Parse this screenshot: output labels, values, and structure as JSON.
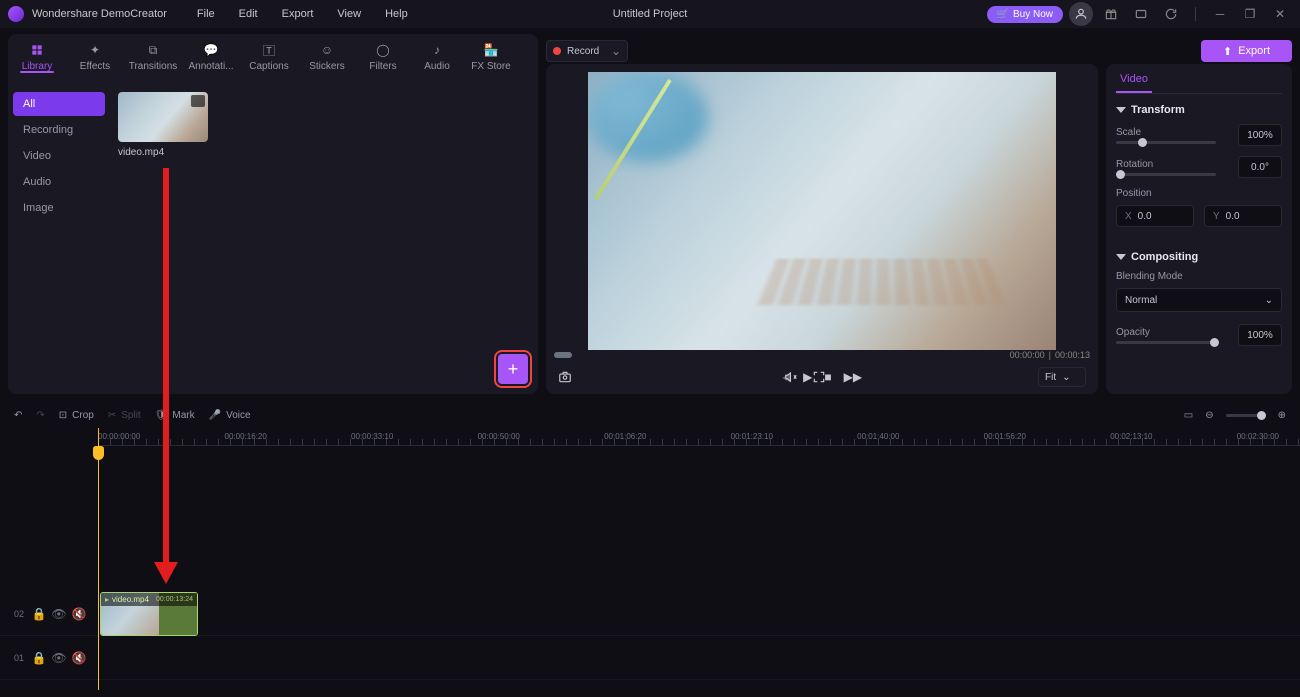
{
  "app": {
    "name": "Wondershare DemoCreator",
    "project_title": "Untitled Project"
  },
  "menus": [
    "File",
    "Edit",
    "Export",
    "View",
    "Help"
  ],
  "title_actions": {
    "buy_now": "Buy Now"
  },
  "media_tabs": [
    "Library",
    "Effects",
    "Transitions",
    "Annotati...",
    "Captions",
    "Stickers",
    "Filters",
    "Audio",
    "FX Store"
  ],
  "record": {
    "label": "Record"
  },
  "export": {
    "label": "Export"
  },
  "sidebar": [
    "All",
    "Recording",
    "Video",
    "Audio",
    "Image"
  ],
  "media_items": [
    {
      "name": "video.mp4"
    }
  ],
  "preview": {
    "current": "00:00:00",
    "total": "00:00:13",
    "fit": "Fit"
  },
  "props": {
    "tab": "Video",
    "transform": {
      "title": "Transform",
      "scale_label": "Scale",
      "scale_value": "100%",
      "rotation_label": "Rotation",
      "rotation_value": "0.0°",
      "position_label": "Position",
      "x_label": "X",
      "x_value": "0.0",
      "y_label": "Y",
      "y_value": "0.0"
    },
    "compositing": {
      "title": "Compositing",
      "blend_label": "Blending Mode",
      "blend_value": "Normal",
      "opacity_label": "Opacity",
      "opacity_value": "100%"
    }
  },
  "tools": {
    "crop": "Crop",
    "split": "Split",
    "mark": "Mark",
    "voice": "Voice"
  },
  "ruler_ticks": [
    "00:00:00:00",
    "00:00:16:20",
    "00:00:33:10",
    "00:00:50:00",
    "00:01:06:20",
    "00:01:23:10",
    "00:01:40:00",
    "00:01:56:20",
    "00:02:13:10",
    "00:02:30:00"
  ],
  "tracks": {
    "t02": "02",
    "t01": "01"
  },
  "clip": {
    "name": "video.mp4",
    "duration": "00:00:13:24"
  }
}
